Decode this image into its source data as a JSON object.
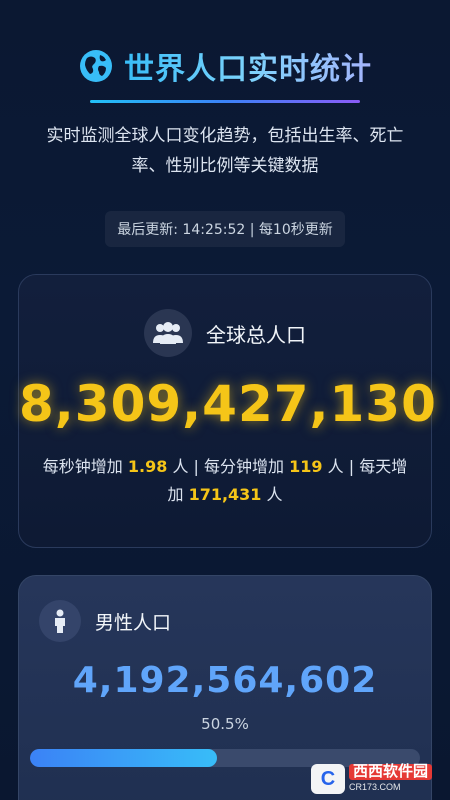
{
  "header": {
    "icon": "globe-icon",
    "title": "世界人口实时统计",
    "subtitle": "实时监测全球人口变化趋势，包括出生率、死亡率、性别比例等关键数据",
    "update_text": "最后更新: 14:25:52 | 每10秒更新"
  },
  "total_card": {
    "icon": "people-icon",
    "label": "全球总人口",
    "value": "8,309,427,130",
    "rates": {
      "per_second_prefix": "每秒钟增加",
      "per_second_value": "1.98",
      "per_second_unit": "人 | 每分钟增加",
      "per_minute_value": "119",
      "per_minute_unit": "人 | 每天增加",
      "per_day_value": "171,431",
      "per_day_unit": "人"
    }
  },
  "male_card": {
    "icon": "male-person-icon",
    "label": "男性人口",
    "value": "4,192,564,602",
    "percent_text": "50.5%",
    "progress_fraction": 0.48
  },
  "watermark": {
    "badge": "C",
    "main": "西西软件园",
    "sub": "CR173.COM"
  },
  "colors": {
    "accent_yellow": "#f5c518",
    "accent_blue": "#60a5fa",
    "background": "#0b1832"
  }
}
